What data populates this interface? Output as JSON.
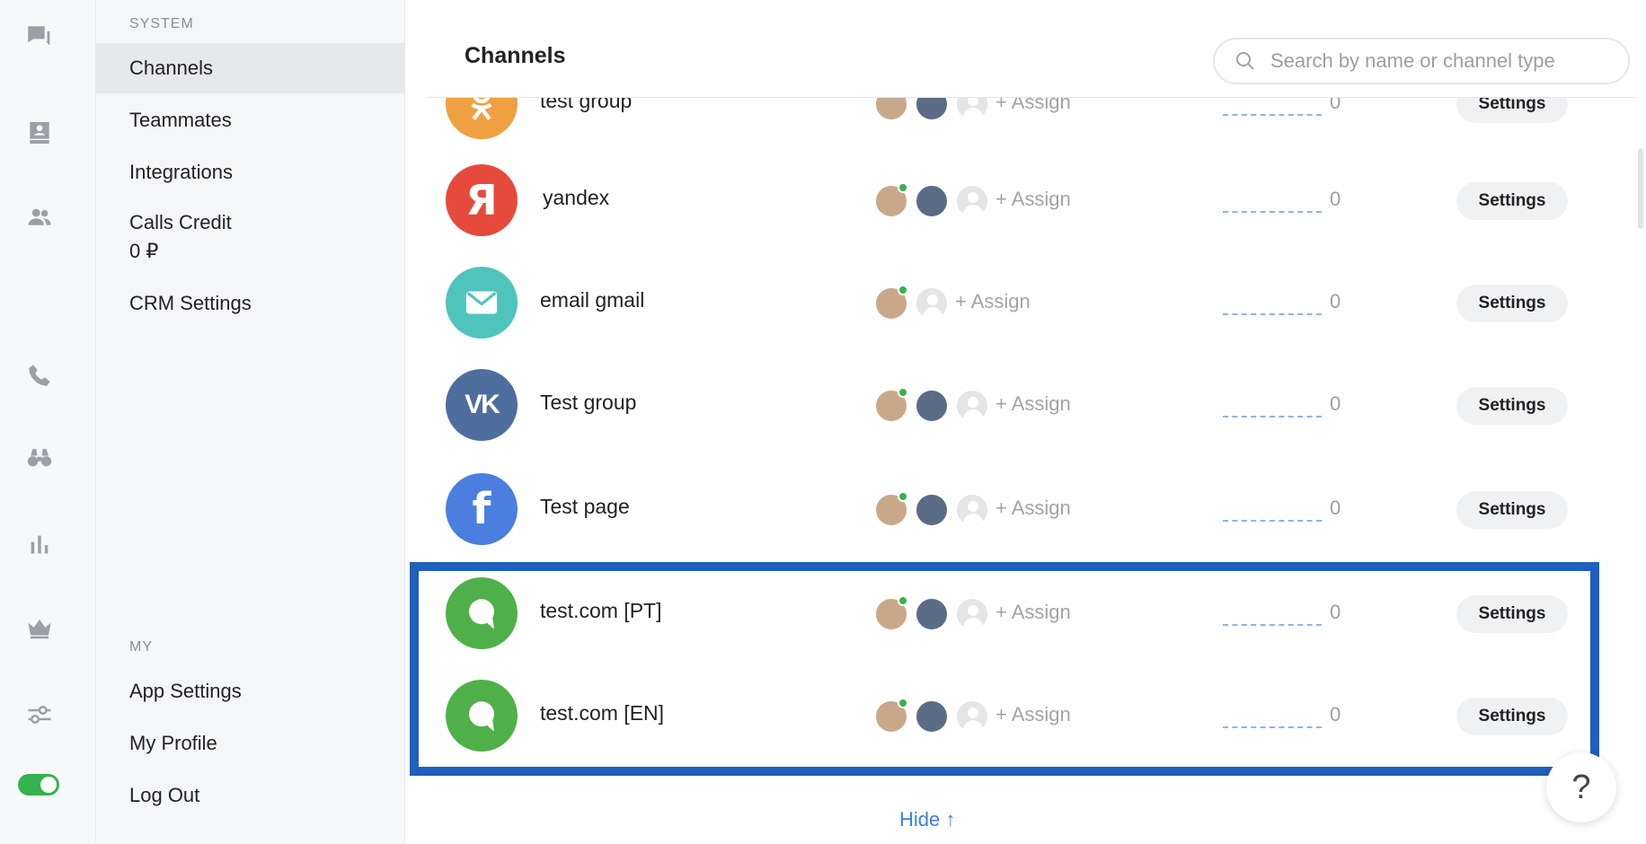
{
  "menu": {
    "system_header": "SYSTEM",
    "system_items": [
      "Channels",
      "Teammates",
      "Integrations",
      "Calls Credit",
      "CRM Settings"
    ],
    "calls_credit_value": "0 ₽",
    "my_header": "MY",
    "my_items": [
      "App Settings",
      "My Profile",
      "Log Out"
    ]
  },
  "main": {
    "title": "Channels",
    "search_placeholder": "Search by name or channel type",
    "assign_label": "+ Assign",
    "settings_label": "Settings",
    "hide_label": "Hide ↑",
    "help_label": "?"
  },
  "channels": [
    {
      "name": "test group",
      "type": "odnoklassniki",
      "color": "#f0a040",
      "count": "0"
    },
    {
      "name": "yandex",
      "type": "yandex",
      "color": "#e64a3b",
      "count": "0"
    },
    {
      "name": "email gmail",
      "type": "email",
      "color": "#4fc4bd",
      "count": "0"
    },
    {
      "name": "Test group",
      "type": "vk",
      "color": "#4e6f9e",
      "count": "0"
    },
    {
      "name": "Test page",
      "type": "facebook",
      "color": "#4a7fe0",
      "count": "0"
    },
    {
      "name": "test.com [PT]",
      "type": "website",
      "color": "#4fb04a",
      "count": "0"
    },
    {
      "name": "test.com [EN]",
      "type": "website",
      "color": "#4fb04a",
      "count": "0"
    }
  ],
  "colors": {
    "accent": "#3d7fe0",
    "highlight": "#1f5fbf",
    "online": "#34b24d"
  }
}
